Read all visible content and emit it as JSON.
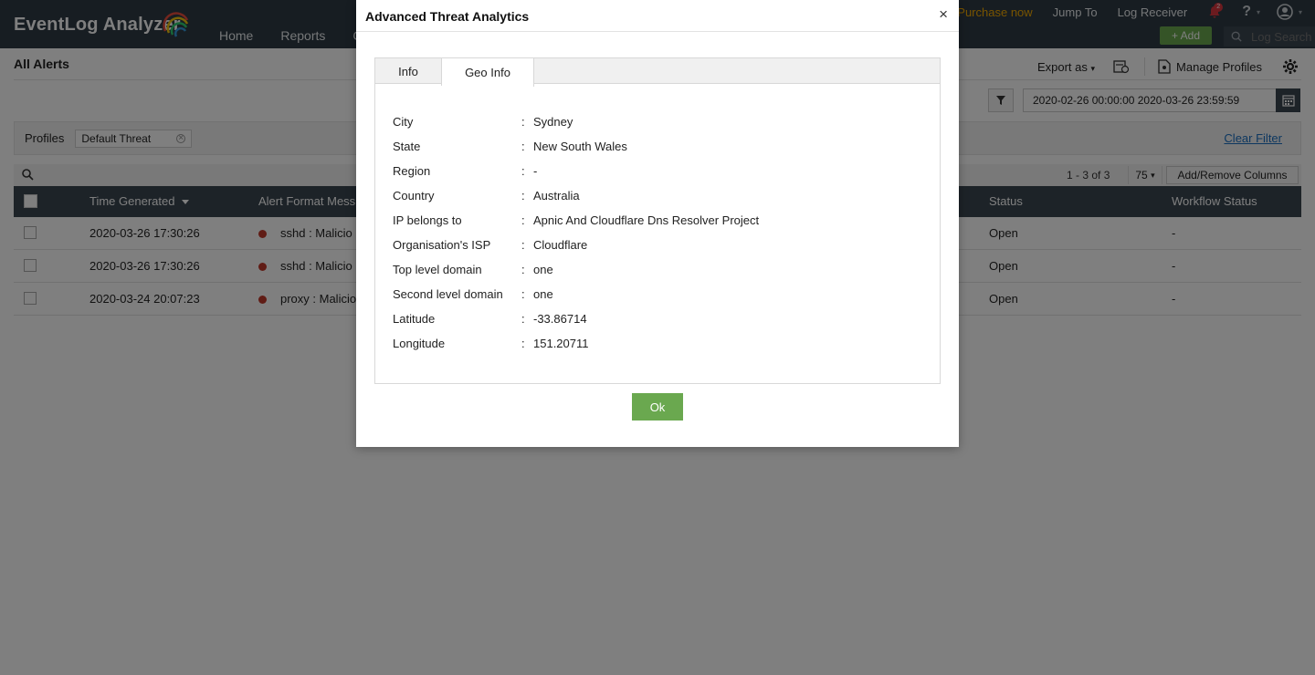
{
  "header": {
    "logo_text": "EventLog Analyzer",
    "nav": [
      "Home",
      "Reports",
      "C"
    ],
    "purchase": "Purchase now",
    "jump_to": "Jump To",
    "log_receiver": "Log Receiver",
    "notification_count": "2",
    "help": "?",
    "add_label": "+ Add",
    "search_placeholder": "Log Search"
  },
  "page": {
    "title": "All Alerts",
    "export_label": "Export as",
    "manage_profiles": "Manage Profiles",
    "date_range": "2020-02-26 00:00:00   2020-03-26 23:59:59",
    "profiles_label": "Profiles",
    "profile_chip": "Default Threat",
    "clear_filter": "Clear Filter",
    "paging": "1 - 3 of 3",
    "per_page": "75",
    "add_remove_columns": "Add/Remove Columns"
  },
  "table": {
    "headers": {
      "time": "Time Generated",
      "alert": "Alert Format Mess",
      "status": "Status",
      "workflow": "Workflow Status"
    },
    "rows": [
      {
        "time": "2020-03-26 17:30:26",
        "alert": "sshd : Malicio",
        "status": "Open",
        "workflow": "-"
      },
      {
        "time": "2020-03-26 17:30:26",
        "alert": "sshd : Malicio",
        "status": "Open",
        "workflow": "-"
      },
      {
        "time": "2020-03-24 20:07:23",
        "alert": "proxy : Malicio",
        "status": "Open",
        "workflow": "-"
      }
    ]
  },
  "modal": {
    "title": "Advanced Threat Analytics",
    "close": "×",
    "tabs": [
      "Info",
      "Geo Info"
    ],
    "active_tab": "Geo Info",
    "geo": [
      {
        "label": "City",
        "value": "Sydney"
      },
      {
        "label": "State",
        "value": "New South Wales"
      },
      {
        "label": "Region",
        "value": "-"
      },
      {
        "label": "Country",
        "value": "Australia"
      },
      {
        "label": "IP belongs to",
        "value": "Apnic And Cloudflare Dns Resolver Project"
      },
      {
        "label": "Organisation's ISP",
        "value": "Cloudflare"
      },
      {
        "label": "Top level domain",
        "value": "one"
      },
      {
        "label": "Second level domain",
        "value": "one"
      },
      {
        "label": "Latitude",
        "value": "-33.86714"
      },
      {
        "label": "Longitude",
        "value": "151.20711"
      }
    ],
    "colon": ":",
    "ok_label": "Ok"
  },
  "colors": {
    "header_bg": "#2f3a44",
    "accent_green": "#6aa84f",
    "purchase_orange": "#f0a800",
    "link_blue": "#1a6fc1",
    "severity_red": "#c0392b"
  }
}
